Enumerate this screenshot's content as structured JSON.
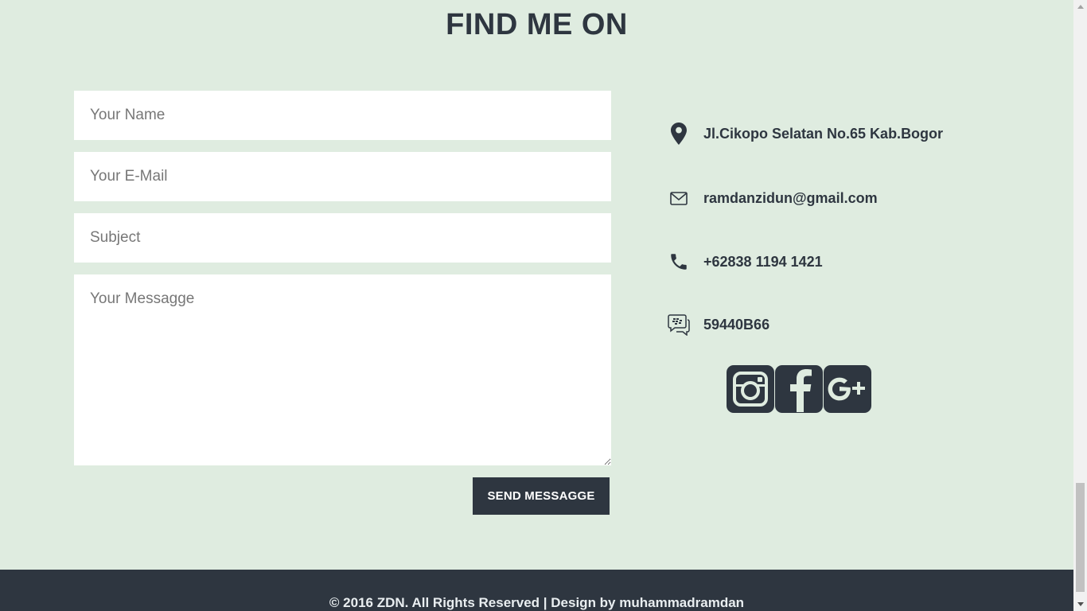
{
  "section": {
    "title": "FIND ME ON"
  },
  "form": {
    "name_placeholder": "Your Name",
    "email_placeholder": "Your E-Mail",
    "subject_placeholder": "Subject",
    "message_placeholder": "Your Messagge",
    "send_label": "SEND MESSAGGE"
  },
  "contact": {
    "address": {
      "icon": "map-marker-icon",
      "text": "Jl.Cikopo Selatan No.65 Kab.Bogor"
    },
    "email": {
      "icon": "envelope-icon",
      "text": "ramdanzidun@gmail.com"
    },
    "phone": {
      "icon": "phone-icon",
      "text": "+62838 1194 1421"
    },
    "bbm": {
      "icon": "bbm-chat-icon",
      "text": "59440B66"
    }
  },
  "social": [
    "instagram-icon",
    "facebook-icon",
    "google-plus-icon"
  ],
  "footer": {
    "text": "© 2016 ZDN. All Rights Reserved | Design by muhammadramdan"
  },
  "colors": {
    "background": "#dfece0",
    "dark": "#2e3640",
    "input_bg": "#ffffff"
  }
}
